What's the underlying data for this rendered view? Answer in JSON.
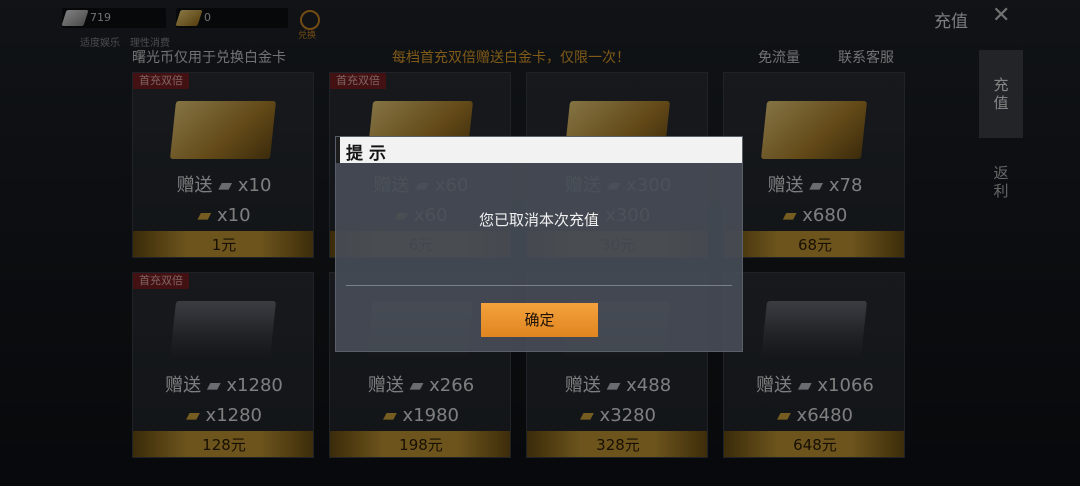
{
  "topbar": {
    "silver_amount": "719",
    "gold_amount": "0",
    "label_left": "适度娱乐",
    "label_right": "理性消费",
    "exchange_label": "兑换",
    "title": "充值"
  },
  "info": {
    "left_text": "曙光币仅用于兑换白金卡",
    "center_text": "每档首充双倍赠送白金卡，仅限一次！",
    "link_free_traffic": "免流量",
    "link_support": "联系客服"
  },
  "side_tabs": [
    {
      "label": "充值",
      "active": true
    },
    {
      "label": "返利",
      "active": false
    }
  ],
  "products": [
    {
      "badge": "首充双倍",
      "bonus_label": "赠送",
      "bonus": "x10",
      "amount": "x10",
      "price": "1元"
    },
    {
      "badge": "首充双倍",
      "bonus_label": "赠送",
      "bonus": "x60",
      "amount": "x60",
      "price": "6元"
    },
    {
      "badge": "",
      "bonus_label": "赠送",
      "bonus": "x300",
      "amount": "x300",
      "price": "30元"
    },
    {
      "badge": "",
      "bonus_label": "赠送",
      "bonus": "x78",
      "amount": "x680",
      "price": "68元"
    },
    {
      "badge": "首充双倍",
      "bonus_label": "赠送",
      "bonus": "x1280",
      "amount": "x1280",
      "price": "128元"
    },
    {
      "badge": "",
      "bonus_label": "赠送",
      "bonus": "x266",
      "amount": "x1980",
      "price": "198元"
    },
    {
      "badge": "",
      "bonus_label": "赠送",
      "bonus": "x488",
      "amount": "x3280",
      "price": "328元"
    },
    {
      "badge": "",
      "bonus_label": "赠送",
      "bonus": "x1066",
      "amount": "x6480",
      "price": "648元"
    }
  ],
  "dialog": {
    "title": "提示",
    "message": "您已取消本次充值",
    "confirm": "确定"
  },
  "colors": {
    "accent_orange": "#f4a23c",
    "gold": "#c79a35",
    "badge_red": "#7a1f1f",
    "info_orange": "#e7a22c"
  }
}
